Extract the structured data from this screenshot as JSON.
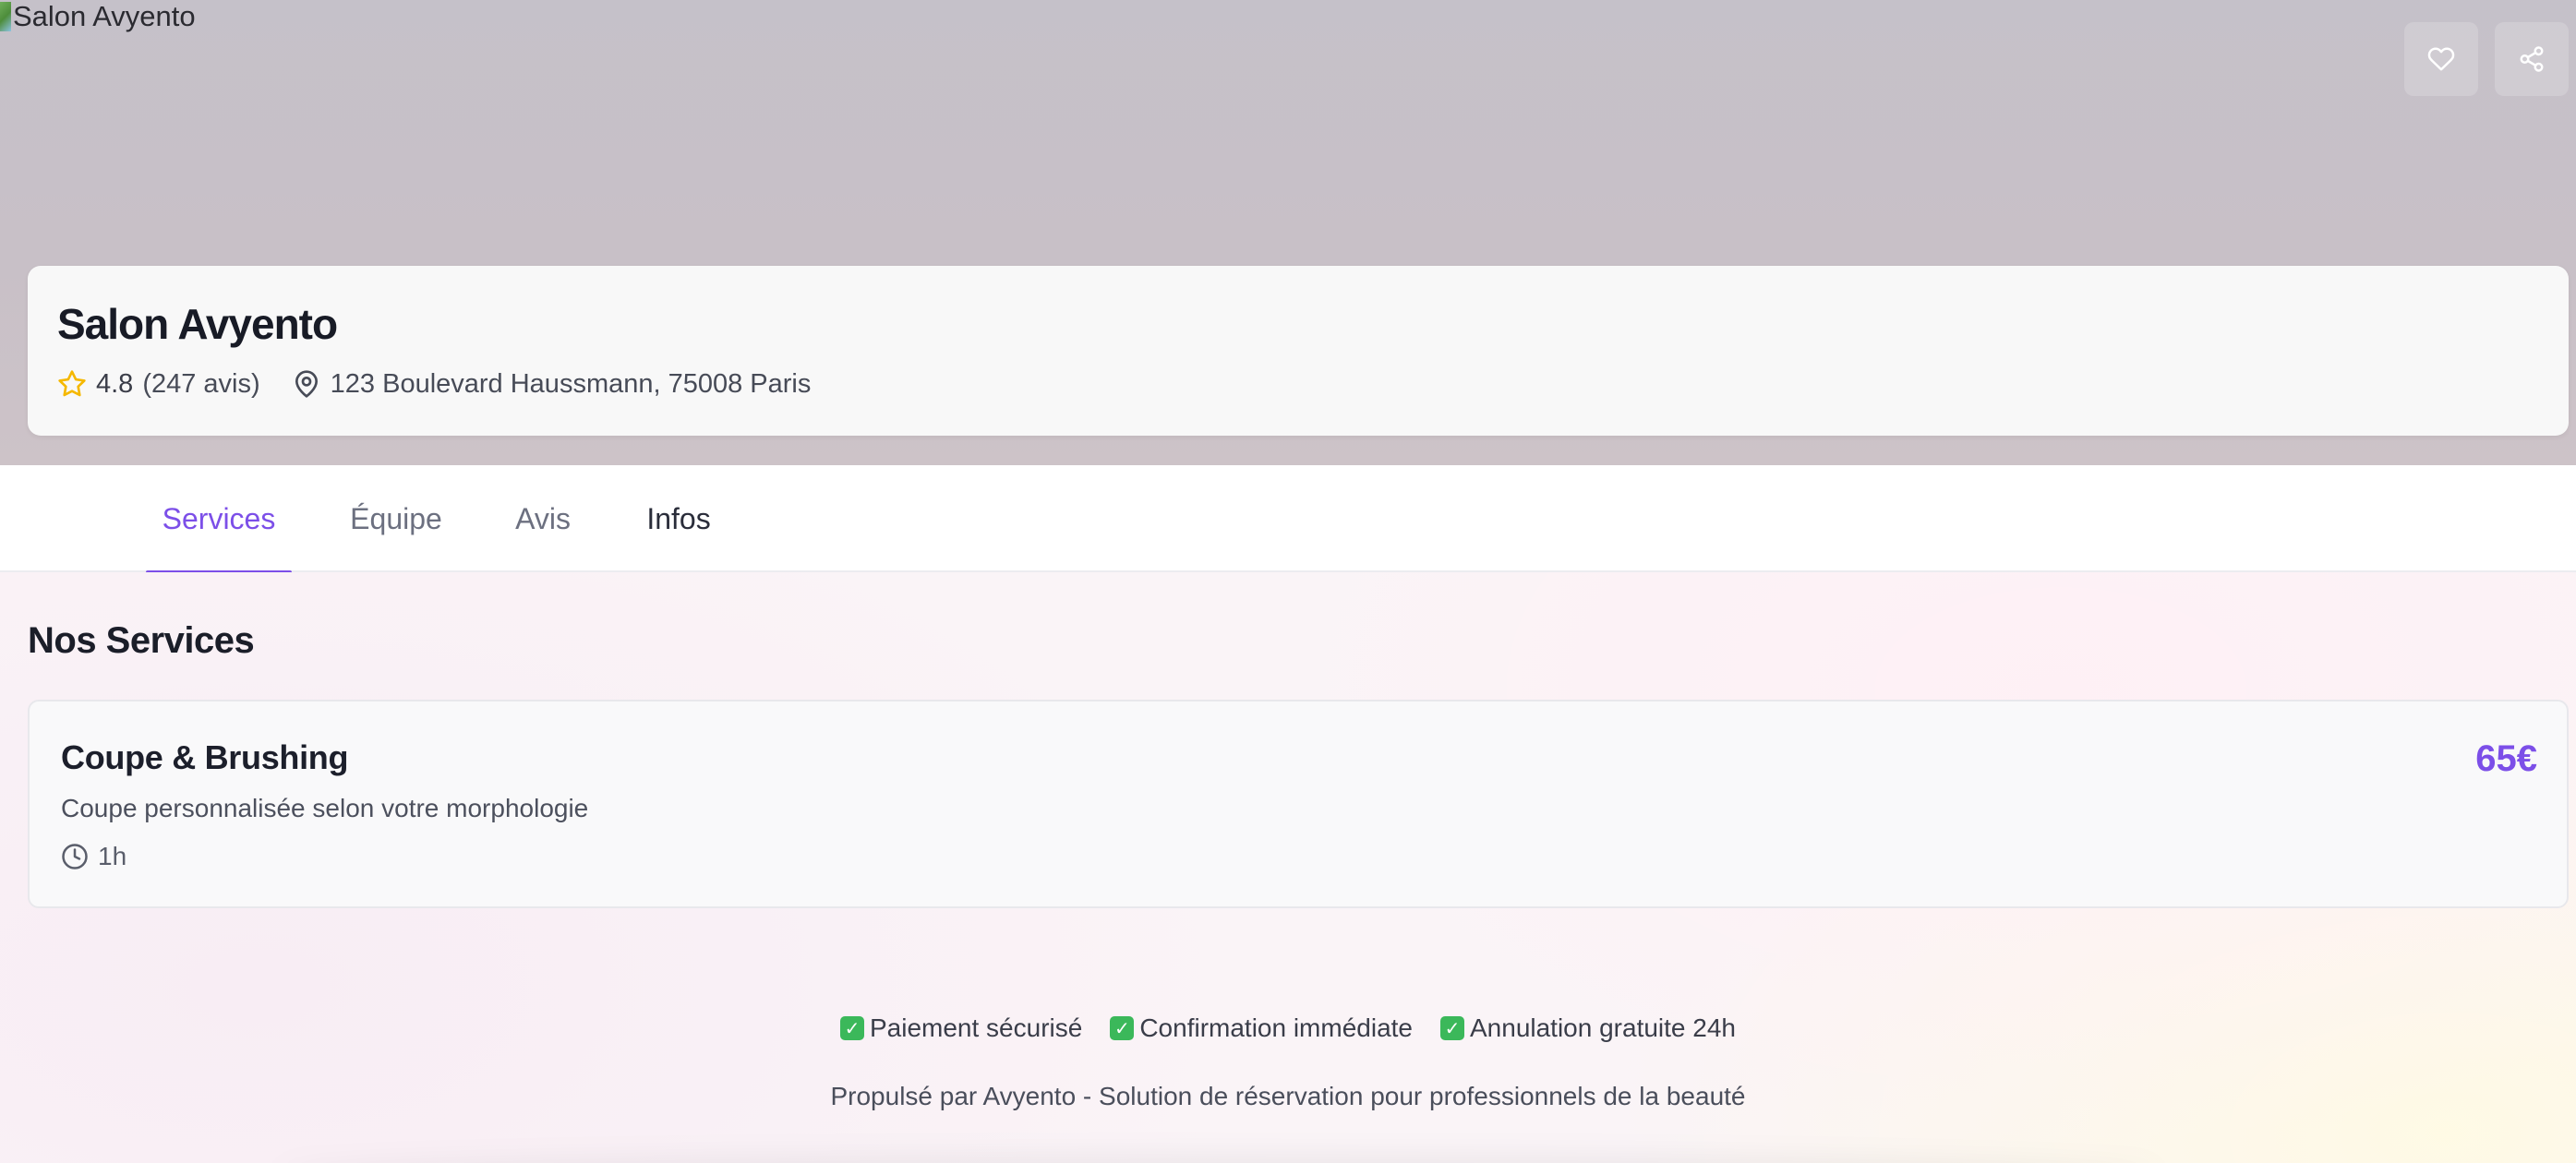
{
  "hero": {
    "image_alt": "Salon Avyento"
  },
  "salon": {
    "name": "Salon Avyento",
    "rating": "4.8",
    "reviews": "(247 avis)",
    "address": "123 Boulevard Haussmann, 75008 Paris"
  },
  "tabs": [
    {
      "label": "Services",
      "active": true
    },
    {
      "label": "Équipe",
      "active": false
    },
    {
      "label": "Avis",
      "active": false
    },
    {
      "label": "Infos",
      "active": false
    }
  ],
  "services": {
    "title": "Nos Services",
    "items": [
      {
        "name": "Coupe & Brushing",
        "description": "Coupe personnalisée selon votre morphologie",
        "duration": "1h",
        "price": "65€"
      }
    ]
  },
  "guarantees": [
    "Paiement sécurisé",
    "Confirmation immédiate",
    "Annulation gratuite 24h"
  ],
  "footer": {
    "text": "Propulsé par Avyento - Solution de réservation pour professionnels de la beauté"
  },
  "colors": {
    "accent": "#7c4fe8",
    "star": "#f5b800"
  }
}
